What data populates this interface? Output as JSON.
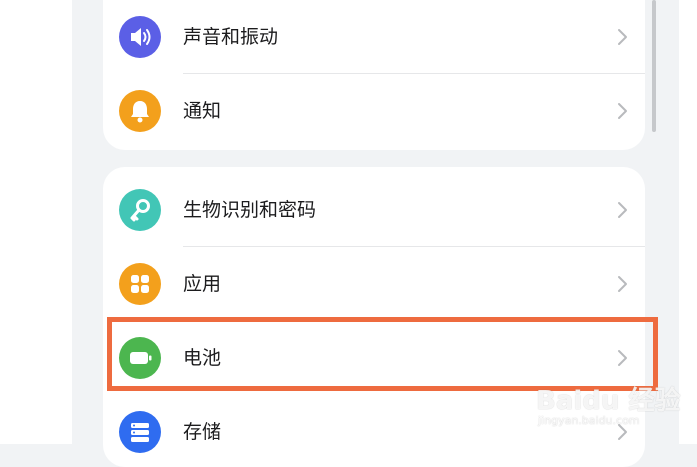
{
  "settings_group_1": {
    "items": [
      {
        "label": "声音和振动",
        "icon": "speaker-icon",
        "icon_color": "#5b5fe6"
      },
      {
        "label": "通知",
        "icon": "bell-icon",
        "icon_color": "#f3a01c"
      }
    ]
  },
  "settings_group_2": {
    "items": [
      {
        "label": "生物识别和密码",
        "icon": "key-icon",
        "icon_color": "#42c6b6"
      },
      {
        "label": "应用",
        "icon": "apps-grid-icon",
        "icon_color": "#f3a01c"
      },
      {
        "label": "电池",
        "icon": "battery-icon",
        "icon_color": "#4cb64f"
      },
      {
        "label": "存储",
        "icon": "storage-icon",
        "icon_color": "#2f6cf0"
      }
    ]
  },
  "highlight": {
    "color": "#ee6b3f",
    "target": "电池"
  },
  "watermark": {
    "logo_text": "Baidu 经验",
    "sub_text": "jingyan.baidu.com"
  }
}
